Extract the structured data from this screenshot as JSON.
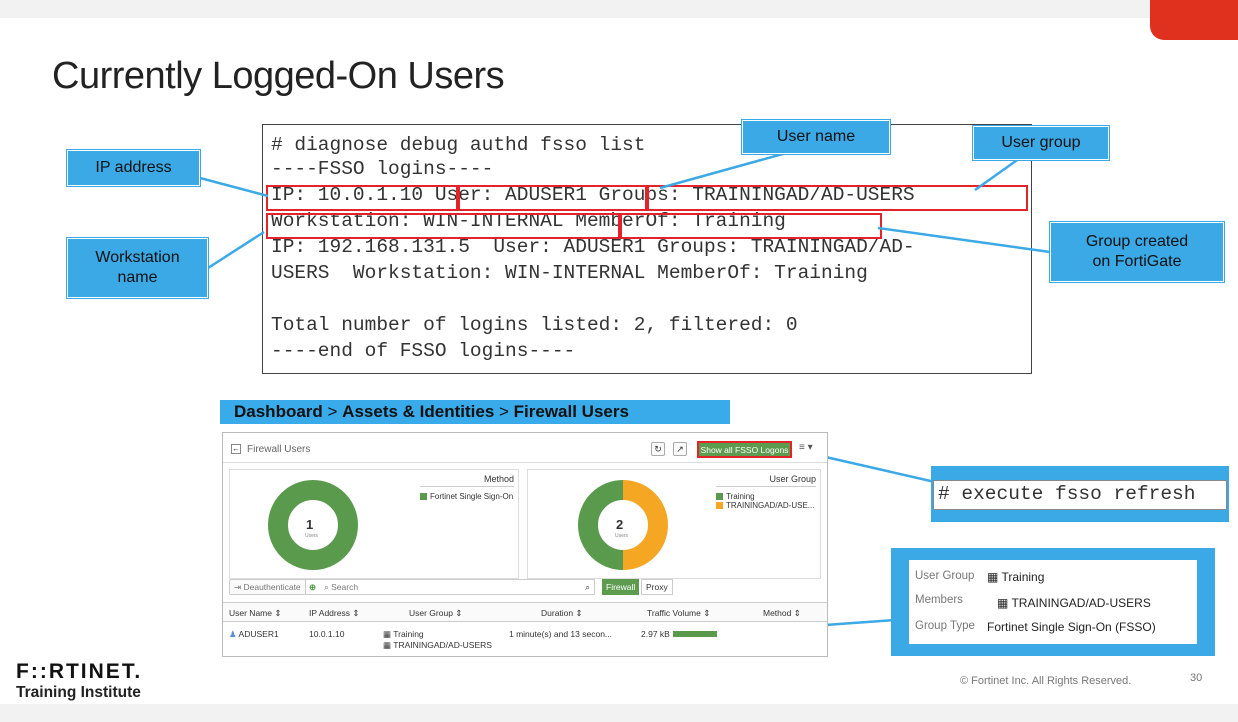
{
  "slide": {
    "title": "Currently Logged-On Users",
    "page_number": "30",
    "copyright": "© Fortinet Inc. All Rights Reserved.",
    "logo_text": "F::RTINET.",
    "logo_sub": "Training Institute",
    "accent_color": "#e0301e",
    "callout_color": "#3aa9e6",
    "highlight_color": "#e3222a"
  },
  "cli": {
    "lines": [
      "# diagnose debug authd fsso list",
      "----FSSO logins----",
      "IP: 10.0.1.10 User: ADUSER1 Groups: TRAININGAD/AD-USERS",
      "Workstation: WIN-INTERNAL MemberOf: Training",
      "IP: 192.168.131.5  User: ADUSER1 Groups: TRAININGAD/AD-",
      "USERS  Workstation: WIN-INTERNAL MemberOf: Training",
      "",
      "Total number of logins listed: 2, filtered: 0",
      "----end of FSSO logins----"
    ]
  },
  "callouts": {
    "ip_address": "IP address",
    "workstation_line1": "Workstation",
    "workstation_line2": "name",
    "user_name": "User name",
    "user_group": "User group",
    "group_created_line1": "Group created",
    "group_created_line2": "on FortiGate"
  },
  "breadcrumb": {
    "part1": "Dashboard",
    "sep1": " > ",
    "part2": "Assets & Identities",
    "sep2": " > ",
    "part3": "Firewall Users"
  },
  "dashboard": {
    "title": "Firewall Users",
    "show_fsso_button": "Show all FSSO Logons",
    "method_panel": {
      "title": "Method",
      "center_value": "1",
      "center_label": "Users",
      "legend": [
        {
          "label": "Fortinet Single Sign-On",
          "color": "#5a9a4c"
        }
      ]
    },
    "group_panel": {
      "title": "User Group",
      "center_value": "2",
      "center_label": "Users",
      "legend": [
        {
          "label": "Training",
          "color": "#5a9a4c"
        },
        {
          "label": "TRAININGAD/AD-USE...",
          "color": "#f5a623"
        }
      ]
    },
    "toolbar": {
      "deauth": "Deauthenticate",
      "search_placeholder": "Search",
      "firewall_tab": "Firewall",
      "proxy_tab": "Proxy"
    },
    "columns": [
      "User Name ⇕",
      "IP Address ⇕",
      "User Group ⇕",
      "Duration ⇕",
      "Traffic Volume ⇕",
      "Method ⇕"
    ],
    "row": {
      "user": "ADUSER1",
      "ip": "10.0.1.10",
      "group1": "Training",
      "group2": "TRAININGAD/AD-USERS",
      "duration": "1 minute(s) and 13 secon...",
      "traffic": "2.97 kB"
    }
  },
  "refresh_command": "# execute fsso refresh",
  "group_detail": {
    "group_label": "User Group",
    "group_value": "Training",
    "members_label": "Members",
    "members_value": "TRAININGAD/AD-USERS",
    "type_label": "Group Type",
    "type_value": "Fortinet Single Sign-On (FSSO)"
  }
}
